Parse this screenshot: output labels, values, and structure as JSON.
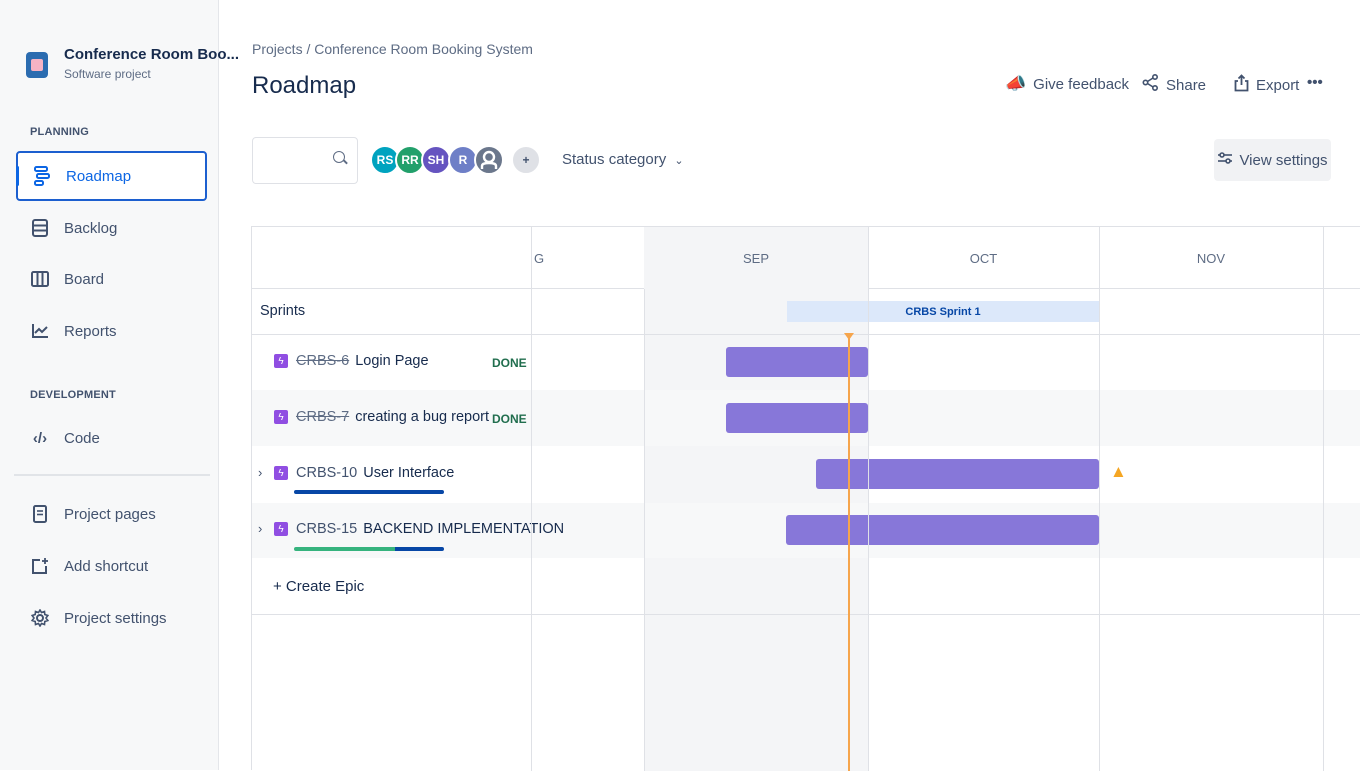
{
  "sidebar": {
    "project_name": "Conference Room Boo...",
    "project_type": "Software project",
    "planning_title": "PLANNING",
    "development_title": "DEVELOPMENT",
    "items": {
      "roadmap": "Roadmap",
      "backlog": "Backlog",
      "board": "Board",
      "reports": "Reports",
      "code": "Code",
      "project_pages": "Project pages",
      "add_shortcut": "Add shortcut",
      "project_settings": "Project settings"
    }
  },
  "header": {
    "breadcrumb": "Projects  /  Conference Room Booking System",
    "title": "Roadmap",
    "give_feedback": "Give feedback",
    "share": "Share",
    "export": "Export",
    "more": "•••"
  },
  "toolbar": {
    "avatars": [
      {
        "initials": "RS",
        "color": "#00a3bf"
      },
      {
        "initials": "RR",
        "color": "#22a06b"
      },
      {
        "initials": "SH",
        "color": "#6554c0"
      },
      {
        "initials": "R",
        "color": "#6e7fc7"
      }
    ],
    "status_category": "Status category",
    "view_settings": "View settings"
  },
  "timeline": {
    "months": [
      "G",
      "SEP",
      "OCT",
      "NOV"
    ],
    "sprints_label": "Sprints",
    "sprint_name": "CRBS Sprint 1",
    "create_epic": "+ Create Epic",
    "epics": [
      {
        "key": "CRBS-6",
        "title": "Login Page",
        "status": "DONE"
      },
      {
        "key": "CRBS-7",
        "title": "creating a bug report",
        "status": "DONE"
      },
      {
        "key": "CRBS-10",
        "title": "User Interface",
        "status": ""
      },
      {
        "key": "CRBS-15",
        "title": "BACKEND IMPLEMENTATION",
        "status": ""
      }
    ]
  },
  "colors": {
    "accent": "#0c66e4",
    "bar": "#8777d9",
    "today": "#f6a54c",
    "progress_blue": "#0747a6",
    "progress_green": "#36b37e"
  }
}
